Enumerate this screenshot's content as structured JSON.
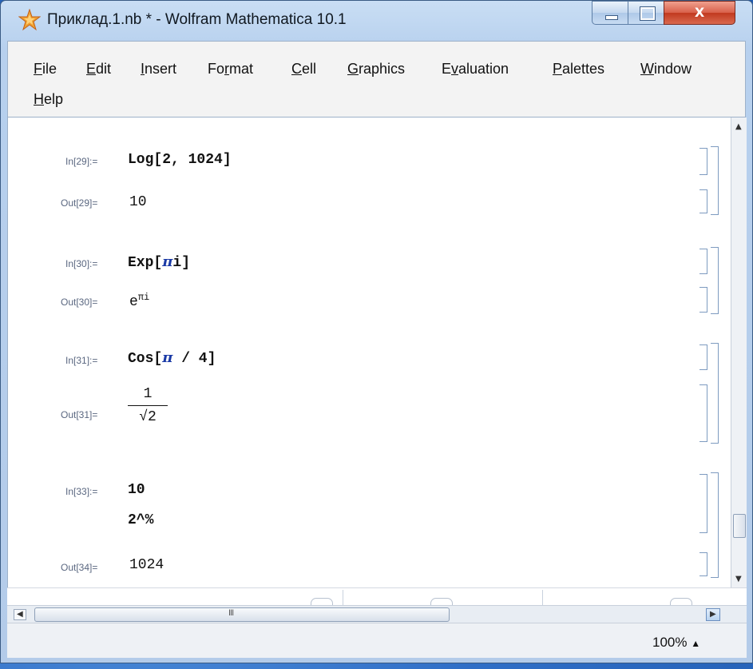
{
  "window": {
    "title": "Приклад.1.nb * - Wolfram Mathematica 10.1",
    "close_glyph": "X"
  },
  "menu": {
    "items": [
      {
        "label": "File",
        "mnemonic": "F",
        "rest": "ile"
      },
      {
        "label": "Edit",
        "mnemonic": "E",
        "rest": "dit"
      },
      {
        "label": "Insert",
        "mnemonic": "I",
        "rest": "nsert"
      },
      {
        "label": "Format",
        "pre": "Fo",
        "mnemonic": "r",
        "rest": "mat"
      },
      {
        "label": "Cell",
        "mnemonic": "C",
        "rest": "ell"
      },
      {
        "label": "Graphics",
        "mnemonic": "G",
        "rest": "raphics"
      },
      {
        "label": "Evaluation",
        "pre": "E",
        "mnemonic": "v",
        "rest": "aluation"
      },
      {
        "label": "Palettes",
        "mnemonic": "P",
        "rest": "alettes"
      },
      {
        "label": "Window",
        "mnemonic": "W",
        "rest": "indow"
      },
      {
        "label": "Help",
        "mnemonic": "H",
        "rest": "elp"
      }
    ]
  },
  "cells": [
    {
      "in_label": "In[29]:=",
      "input": "Log[2, 1024]",
      "out_label": "Out[29]=",
      "output": "10"
    },
    {
      "in_label": "In[30]:=",
      "input_head": "Exp[",
      "input_pi": "π",
      "input_i": "i",
      "input_tail": "]",
      "out_label": "Out[30]=",
      "output_base": "e",
      "output_sup": "πi"
    },
    {
      "in_label": "In[31]:=",
      "input_head": "Cos[",
      "input_pi": "π",
      "input_tail": " / 4]",
      "out_label": "Out[31]=",
      "output_num": "1",
      "output_den": "√2"
    },
    {
      "in_label": "In[33]:=",
      "input_line1": "10",
      "input_line2": "2^%",
      "out_label": "Out[34]=",
      "output": "1024"
    }
  ],
  "status": {
    "zoom": "100%",
    "scroll_mark": "III"
  },
  "colors": {
    "pi_color": "#1a3aa6",
    "label_color": "#5a6780"
  }
}
